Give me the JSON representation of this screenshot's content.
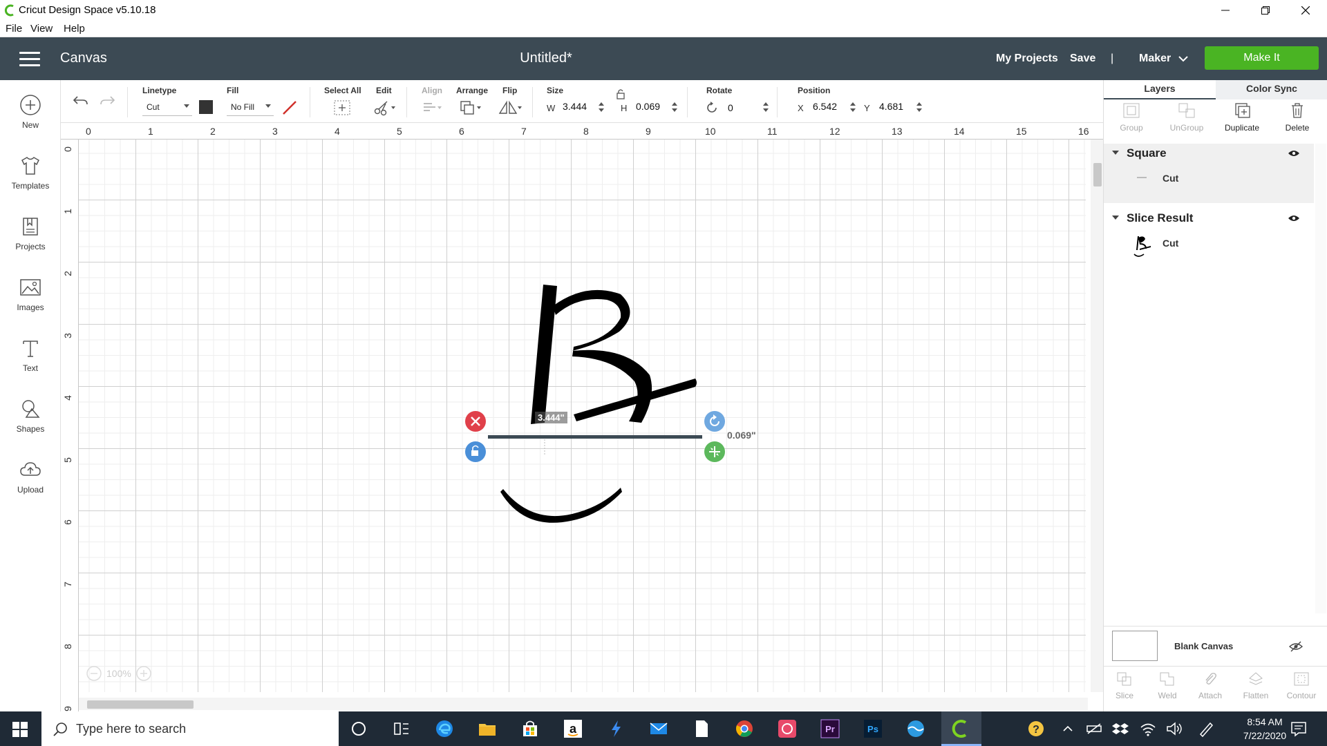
{
  "window": {
    "title": "Cricut Design Space  v5.10.18"
  },
  "menu": {
    "items": [
      "File",
      "View",
      "Help"
    ]
  },
  "header": {
    "section": "Canvas",
    "project_name": "Untitled*",
    "my_projects": "My Projects",
    "save": "Save",
    "separator": "|",
    "machine": "Maker",
    "make_it": "Make It"
  },
  "sidebar": {
    "items": [
      {
        "label": "New",
        "icon": "plus-circle-icon"
      },
      {
        "label": "Templates",
        "icon": "tshirt-icon"
      },
      {
        "label": "Projects",
        "icon": "bookmark-icon"
      },
      {
        "label": "Images",
        "icon": "image-icon"
      },
      {
        "label": "Text",
        "icon": "text-icon"
      },
      {
        "label": "Shapes",
        "icon": "shapes-icon"
      },
      {
        "label": "Upload",
        "icon": "cloud-upload-icon"
      }
    ]
  },
  "toolbar": {
    "linetype_label": "Linetype",
    "linetype_value": "Cut",
    "fill_label": "Fill",
    "fill_value": "No Fill",
    "select_all_label": "Select All",
    "edit_label": "Edit",
    "align_label": "Align",
    "arrange_label": "Arrange",
    "flip_label": "Flip",
    "size_label": "Size",
    "w_label": "W",
    "w_value": "3.444",
    "h_label": "H",
    "h_value": "0.069",
    "rotate_label": "Rotate",
    "rotate_value": "0",
    "position_label": "Position",
    "x_label": "X",
    "x_value": "6.542",
    "y_label": "Y",
    "y_value": "4.681",
    "color_swatch": "#333333"
  },
  "rulers": {
    "horizontal": [
      "0",
      "1",
      "2",
      "3",
      "4",
      "5",
      "6",
      "7",
      "8",
      "9",
      "10",
      "11",
      "12",
      "13",
      "14",
      "15",
      "16"
    ],
    "vertical": [
      "0",
      "1",
      "2",
      "3",
      "4",
      "5",
      "6",
      "7",
      "8",
      "9"
    ]
  },
  "canvas": {
    "width_readout": "3.444\"",
    "height_readout": "0.069\"",
    "zoom": "100%"
  },
  "right_panel": {
    "tabs": [
      "Layers",
      "Color Sync"
    ],
    "tools": [
      "Group",
      "UnGroup",
      "Duplicate",
      "Delete"
    ],
    "layers": [
      {
        "name": "Square",
        "sub": "Cut"
      },
      {
        "name": "Slice Result",
        "sub": "Cut"
      }
    ],
    "blank_canvas": "Blank Canvas",
    "bottom_tools": [
      "Slice",
      "Weld",
      "Attach",
      "Flatten",
      "Contour"
    ]
  },
  "taskbar": {
    "search_placeholder": "Type here to search",
    "time": "8:54 AM",
    "date": "7/22/2020"
  }
}
